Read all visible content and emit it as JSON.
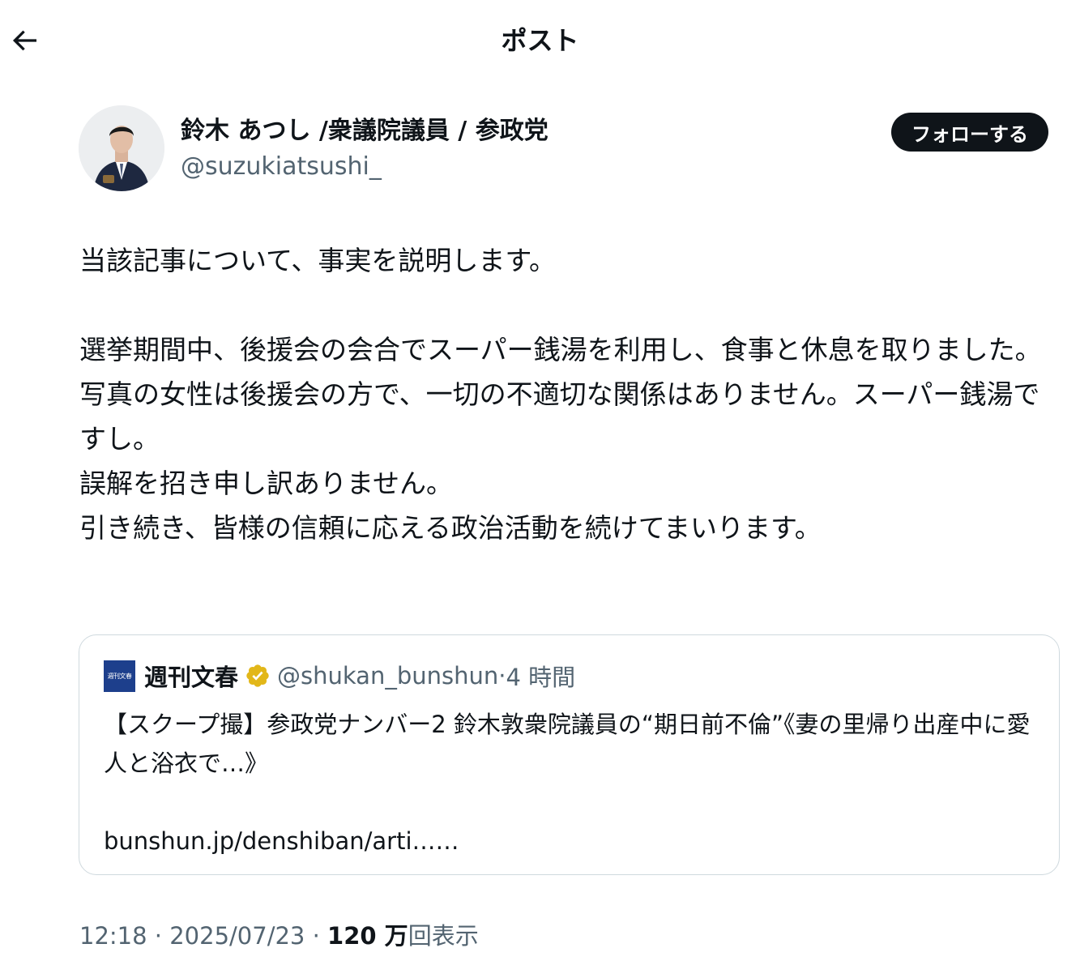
{
  "header": {
    "title": "ポスト",
    "back_icon": "arrow-left-icon"
  },
  "author": {
    "name": "鈴木 あつし /衆議院議員 / 参政党",
    "handle": "@suzukiatsushi_",
    "follow_label": "フォローする"
  },
  "post": {
    "paragraphs": [
      "当該記事について、事実を説明します。",
      "",
      "選挙期間中、後援会の会合でスーパー銭湯を利用し、食事と休息を取りました。",
      "写真の女性は後援会の方で、一切の不適切な関係はありません。スーパー銭湯ですし。",
      "誤解を招き申し訳ありません。",
      "引き続き、皆様の信頼に応える政治活動を続けてまいります。"
    ]
  },
  "quote": {
    "logo_text": "週刊文春",
    "name": "週刊文春",
    "verified_icon": "verified-badge-icon",
    "verified_color": "#e2b719",
    "handle": "@shukan_bunshun",
    "dot": "·",
    "time": "4 時間",
    "text_lines": [
      "【スクープ撮】参政党ナンバー2 鈴木敦衆院議員の“期日前不倫”《妻の里帰り出産中に愛人と浴衣で…》",
      "",
      "bunshun.jp/denshiban/arti……"
    ]
  },
  "meta": {
    "time": "12:18",
    "sep1": " · ",
    "date": "2025/07/23",
    "sep2": " · ",
    "view_count": "120 万",
    "view_label": "回表示"
  }
}
